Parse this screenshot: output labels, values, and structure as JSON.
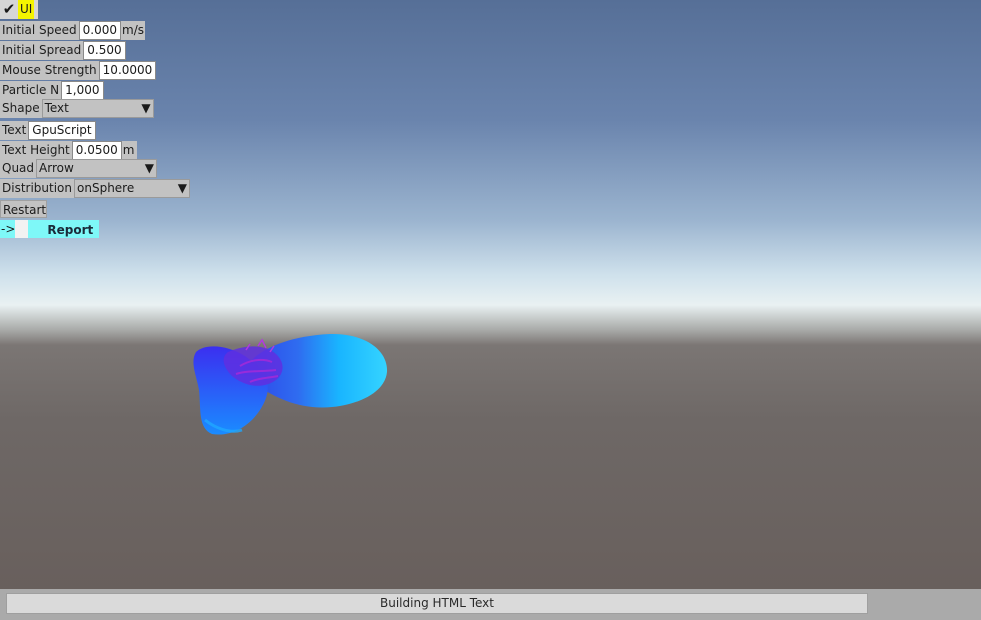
{
  "ui_toggle": {
    "checked": true,
    "label": "UI"
  },
  "controls": {
    "initial_speed": {
      "label": "Initial Speed",
      "value": "0.000",
      "unit": "m/s"
    },
    "initial_spread": {
      "label": "Initial Spread",
      "value": "0.500"
    },
    "mouse_strength": {
      "label": "Mouse Strength",
      "value": "10.0000"
    },
    "particle_n": {
      "label": "Particle N",
      "value": "1,000"
    },
    "shape": {
      "label": "Shape",
      "selected": "Text"
    },
    "text": {
      "label": "Text",
      "value": "GpuScript"
    },
    "text_height": {
      "label": "Text Height",
      "value": "0.0500",
      "unit": "m"
    },
    "quad": {
      "label": "Quad",
      "selected": "Arrow"
    },
    "distribution": {
      "label": "Distribution",
      "selected": "onSphere"
    },
    "restart_label": "Restart",
    "report": {
      "arrow": "->",
      "label": "Report"
    }
  },
  "status": {
    "text": "Building HTML Text"
  },
  "colors": {
    "toggle_highlight": "#f4f400",
    "report_accent": "#7ef8f8",
    "particle_cyan": "#18bfff",
    "particle_blue": "#2a3fe8",
    "particle_purple": "#8a22d8"
  },
  "scene": {
    "object": "particle-cloud"
  }
}
